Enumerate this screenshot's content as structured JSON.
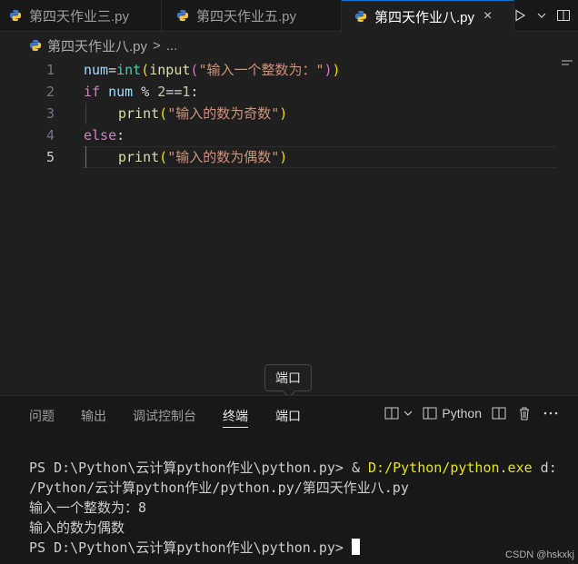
{
  "tabs": [
    {
      "label": "第四天作业三.py"
    },
    {
      "label": "第四天作业五.py"
    },
    {
      "label": "第四天作业八.py"
    }
  ],
  "active_tab_close": "×",
  "breadcrumb": {
    "file": "第四天作业八.py",
    "sep": ">",
    "more": "..."
  },
  "editor": {
    "line_numbers": [
      "1",
      "2",
      "3",
      "4",
      "5"
    ],
    "l1": {
      "a": "num",
      "b": "=",
      "c": "int",
      "d": "(",
      "e": "input",
      "f": "(",
      "g": "\"输入一个整数为：\"",
      "h": ")",
      "i": ")"
    },
    "l2": {
      "a": "if",
      "b": " num ",
      "c": "%",
      "d": " 2",
      "e": "==",
      "f": "1",
      ":": ":"
    },
    "l3": {
      "a": "print",
      "b": "(",
      "c": "\"输入的数为奇数\"",
      "d": ")"
    },
    "l4": {
      "a": "else",
      ":": ":"
    },
    "l5": {
      "a": "print",
      "b": "(",
      "c": "\"输入的数为偶数\"",
      "d": ")"
    }
  },
  "tooltip": "端口",
  "panel": {
    "tabs": [
      "问题",
      "输出",
      "调试控制台",
      "终端",
      "端口"
    ],
    "shell_label": "Python"
  },
  "terminal": {
    "l1_prompt": "PS D:\\Python\\云计算python作业\\python.py> & ",
    "l1_exe": "D:/Python/python.exe",
    "l1_rest": " d:",
    "l2": "/Python/云计算python作业/python.py/第四天作业八.py",
    "l3": "输入一个整数为：8",
    "l4": "输入的数为偶数",
    "l5_prompt": "PS D:\\Python\\云计算python作业\\python.py> "
  },
  "watermark": "CSDN @hskxkj"
}
